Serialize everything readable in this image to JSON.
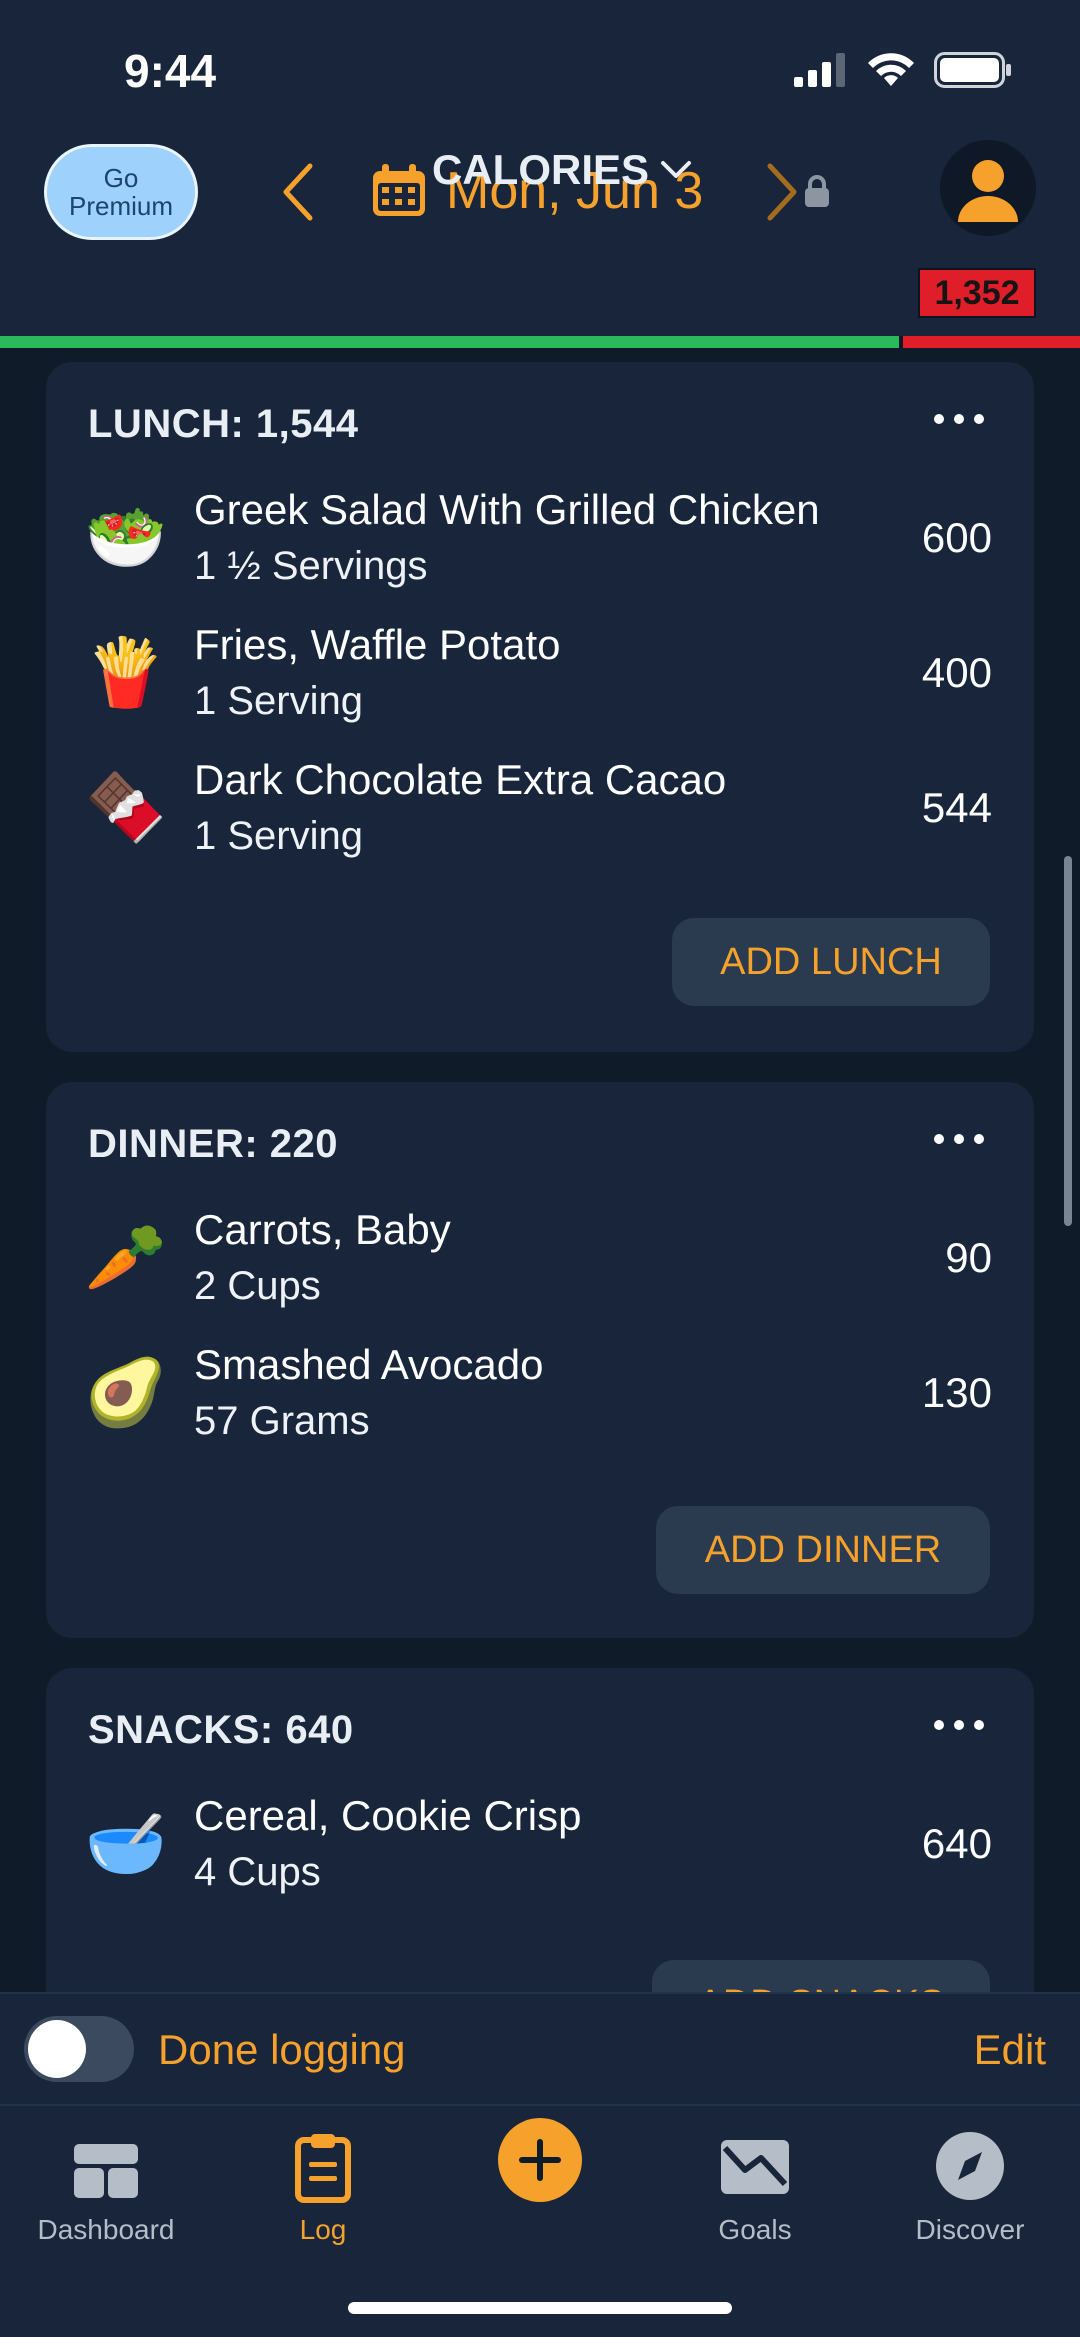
{
  "status_bar": {
    "time": "9:44"
  },
  "header": {
    "premium_line1": "Go",
    "premium_line2": "Premium",
    "date": "Mon, Jun 3",
    "metric": "CALORIES",
    "over_value": "1,352"
  },
  "meals": [
    {
      "title": "LUNCH: 1,544",
      "add_label": "ADD LUNCH",
      "items": [
        {
          "emoji": "🥗",
          "name": "Greek Salad With Grilled Chicken",
          "qty": "1 ½ Servings",
          "cal": "600"
        },
        {
          "emoji": "🍟",
          "name": "Fries, Waffle Potato",
          "qty": "1 Serving",
          "cal": "400"
        },
        {
          "emoji": "🍫",
          "name": "Dark Chocolate Extra Cacao",
          "qty": "1 Serving",
          "cal": "544"
        }
      ]
    },
    {
      "title": "DINNER: 220",
      "add_label": "ADD DINNER",
      "items": [
        {
          "emoji": "🥕",
          "name": "Carrots, Baby",
          "qty": "2 Cups",
          "cal": "90"
        },
        {
          "emoji": "🥑",
          "name": "Smashed Avocado",
          "qty": "57 Grams",
          "cal": "130"
        }
      ]
    },
    {
      "title": "SNACKS: 640",
      "add_label": "ADD SNACKS",
      "items": [
        {
          "emoji": "🥣",
          "name": "Cereal, Cookie Crisp",
          "qty": "4 Cups",
          "cal": "640"
        }
      ]
    }
  ],
  "done_bar": {
    "label": "Done logging",
    "edit": "Edit"
  },
  "tabs": [
    {
      "label": "Dashboard",
      "icon": "dashboard-icon"
    },
    {
      "label": "Log",
      "icon": "clipboard-icon"
    },
    {
      "label": "",
      "icon": "add-icon"
    },
    {
      "label": "Goals",
      "icon": "goals-chart-icon"
    },
    {
      "label": "Discover",
      "icon": "compass-icon"
    }
  ],
  "colors": {
    "accent": "#f5a12c",
    "over": "#e01e2a",
    "progress": "#2bba5b",
    "card": "#18253a",
    "bg": "#101b2a"
  }
}
